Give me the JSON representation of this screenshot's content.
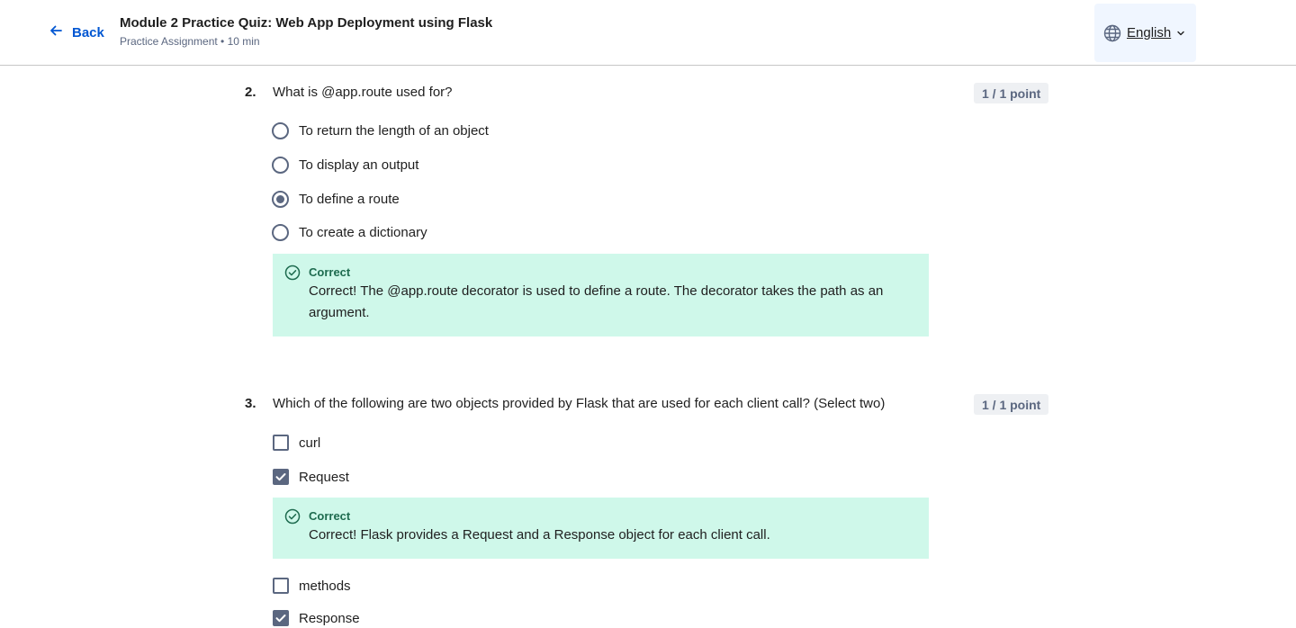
{
  "header": {
    "back_label": "Back",
    "title": "Module 2 Practice Quiz: Web App Deployment using Flask",
    "subtitle": "Practice Assignment • 10 min",
    "language": "English",
    "icons": {
      "back": "arrow-left-icon",
      "language": "globe-icon",
      "dropdown": "chevron-down-icon"
    }
  },
  "colors": {
    "link": "#0056d2",
    "correct_bg": "#cff8ea",
    "correct_text": "#1e6b4f",
    "control": "#5b6780"
  },
  "questions": [
    {
      "number": "2.",
      "text": "What is @app.route used for?",
      "points": "1 / 1 point",
      "type": "radio",
      "options": [
        {
          "label": "To return the length of an object",
          "selected": false
        },
        {
          "label": "To display an output",
          "selected": false
        },
        {
          "label": "To define a route",
          "selected": true
        },
        {
          "label": "To create a dictionary",
          "selected": false
        }
      ],
      "feedback": {
        "status": "Correct",
        "text": "Correct! The @app.route decorator is used to define a route. The decorator takes the path as an argument."
      }
    },
    {
      "number": "3.",
      "text": "Which of the following are two objects provided by Flask that are used for each client call? (Select two)",
      "points": "1 / 1 point",
      "type": "checkbox",
      "options": [
        {
          "label": "curl",
          "selected": false
        },
        {
          "label": "Request",
          "selected": true
        },
        {
          "label": "methods",
          "selected": false
        },
        {
          "label": "Response",
          "selected": true
        }
      ],
      "feedback": {
        "status": "Correct",
        "text": "Correct! Flask provides a Request and a Response object for each client call."
      }
    }
  ]
}
